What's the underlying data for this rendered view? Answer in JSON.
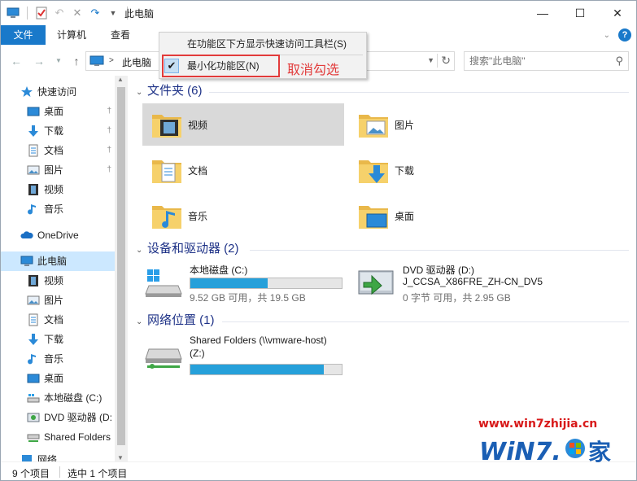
{
  "window": {
    "title": "此电脑",
    "controls": [
      "minimize",
      "maximize",
      "close"
    ]
  },
  "qat": {
    "icons": [
      "computer-icon",
      "properties-icon",
      "undo-icon",
      "delete-icon",
      "redo-icon",
      "customize-dropdown-icon"
    ]
  },
  "ribbon": {
    "tabs": [
      {
        "label": "文件",
        "active": true
      },
      {
        "label": "计算机"
      },
      {
        "label": "查看"
      }
    ],
    "help": "?"
  },
  "menu": {
    "item1": "在功能区下方显示快速访问工具栏(S)",
    "item2": "最小化功能区(N)",
    "item2_checked": true
  },
  "annotation": {
    "text": "取消勾选",
    "color": "#e23b3b"
  },
  "address": {
    "separator": ">",
    "location": "此电脑"
  },
  "search": {
    "placeholder": "搜索\"此电脑\""
  },
  "nav": {
    "items": [
      {
        "label": "快速访问",
        "icon": "star-icon",
        "level": 0
      },
      {
        "label": "桌面",
        "icon": "desktop-icon",
        "level": 1,
        "pinned": true
      },
      {
        "label": "下载",
        "icon": "download-icon",
        "level": 1,
        "pinned": true
      },
      {
        "label": "文档",
        "icon": "document-icon",
        "level": 1,
        "pinned": true
      },
      {
        "label": "图片",
        "icon": "pictures-icon",
        "level": 1,
        "pinned": true
      },
      {
        "label": "视频",
        "icon": "video-icon",
        "level": 1
      },
      {
        "label": "音乐",
        "icon": "music-icon",
        "level": 1
      },
      {
        "label": "OneDrive",
        "icon": "cloud-icon",
        "level": 0
      },
      {
        "label": "此电脑",
        "icon": "computer-icon",
        "level": 0,
        "selected": true
      },
      {
        "label": "视频",
        "icon": "video-icon",
        "level": 1
      },
      {
        "label": "图片",
        "icon": "pictures-icon",
        "level": 1
      },
      {
        "label": "文档",
        "icon": "document-icon",
        "level": 1
      },
      {
        "label": "下载",
        "icon": "download-icon",
        "level": 1
      },
      {
        "label": "音乐",
        "icon": "music-icon",
        "level": 1
      },
      {
        "label": "桌面",
        "icon": "desktop-icon",
        "level": 1
      },
      {
        "label": "本地磁盘 (C:)",
        "icon": "drive-icon",
        "level": 1
      },
      {
        "label": "DVD 驱动器 (D:",
        "icon": "dvd-icon",
        "level": 1
      },
      {
        "label": "Shared Folders",
        "icon": "network-drive-icon",
        "level": 1
      },
      {
        "label": "网络",
        "icon": "network-icon",
        "level": 0
      }
    ]
  },
  "groups": {
    "folders": "文件夹 (6)",
    "devices": "设备和驱动器 (2)",
    "network": "网络位置 (1)"
  },
  "folders": [
    {
      "label": "视频",
      "icon": "video-folder-icon",
      "selected": true
    },
    {
      "label": "图片",
      "icon": "pictures-folder-icon"
    },
    {
      "label": "文档",
      "icon": "documents-folder-icon"
    },
    {
      "label": "下载",
      "icon": "downloads-folder-icon"
    },
    {
      "label": "音乐",
      "icon": "music-folder-icon"
    },
    {
      "label": "桌面",
      "icon": "desktop-folder-icon"
    }
  ],
  "drives": {
    "c": {
      "name": "本地磁盘 (C:)",
      "free": "9.52 GB 可用，共 19.5 GB",
      "used_fraction": 0.51
    },
    "d": {
      "name": "DVD 驱动器 (D:)",
      "label": "J_CCSA_X86FRE_ZH-CN_DV5",
      "free": "0 字节 可用，共 2.95 GB"
    },
    "z": {
      "name": "Shared Folders (\\\\vmware-host)",
      "letter": "(Z:)",
      "used_fraction": 0.88
    }
  },
  "status": {
    "count": "9 个项目",
    "selected": "选中 1 个项目"
  },
  "watermark": {
    "url": "www.win7zhijia.cn",
    "logo": "WiN7.家"
  },
  "colors": {
    "accent": "#1979ca",
    "bar": "#26a0da",
    "selection": "#cce8ff",
    "group_header": "#1e3287"
  }
}
